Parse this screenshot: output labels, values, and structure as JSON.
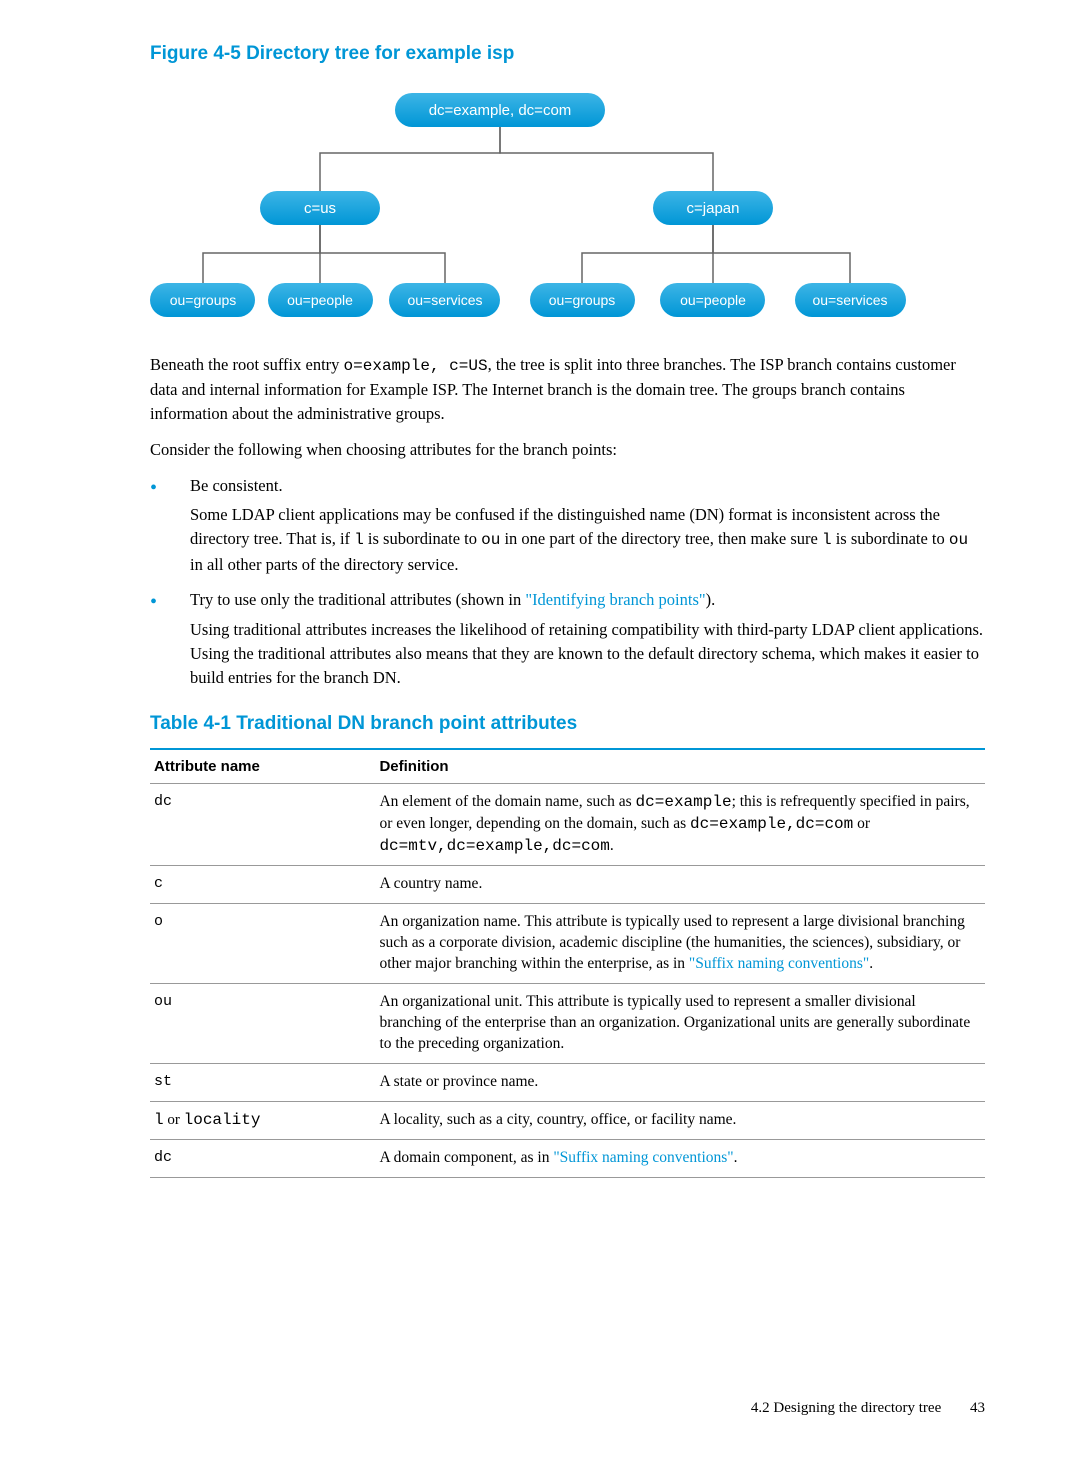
{
  "figure": {
    "title": "Figure 4-5 Directory tree for example isp",
    "nodes": {
      "root": "dc=example, dc=com",
      "us": "c=us",
      "japan": "c=japan",
      "groups": "ou=groups",
      "people": "ou=people",
      "services": "ou=services"
    }
  },
  "paragraphs": {
    "p1_a": "Beneath the root suffix entry ",
    "p1_code1": "o=example, c=US",
    "p1_b": ", the tree is split into three branches. The ISP branch contains customer data and internal information for Example ISP. The Internet branch is the domain tree. The groups branch contains information about the administrative groups.",
    "p2": "Consider the following when choosing attributes for the branch points:"
  },
  "bullets": {
    "b1_head": "Be consistent.",
    "b1_sub_a": "Some LDAP client applications may be confused if the distinguished name (DN) format is inconsistent across the directory tree. That is, if ",
    "b1_code1": "l",
    "b1_sub_b": " is subordinate to ",
    "b1_code2": "ou",
    "b1_sub_c": " in one part of the directory tree, then make sure ",
    "b1_code3": "l",
    "b1_sub_d": " is subordinate to ",
    "b1_code4": "ou",
    "b1_sub_e": " in all other parts of the directory service.",
    "b2_a": "Try to use only the traditional attributes (shown in ",
    "b2_link": "\"Identifying branch points\"",
    "b2_b": ").",
    "b2_sub": "Using traditional attributes increases the likelihood of retaining compatibility with third-party LDAP client applications. Using the traditional attributes also means that they are known to the default directory schema, which makes it easier to build entries for the branch DN."
  },
  "table": {
    "title": "Table 4-1 Traditional DN branch point attributes",
    "headers": {
      "col1": "Attribute name",
      "col2": "Definition"
    },
    "rows": [
      {
        "attr": "dc",
        "def_a": "An element of the domain name, such as ",
        "def_code1": "dc=example",
        "def_b": "; this is refrequently specified in pairs, or even longer, depending on the domain, such as ",
        "def_code2": "dc=example,dc=com",
        "def_c": " or ",
        "def_code3": "dc=mtv,dc=example,dc=com",
        "def_d": "."
      },
      {
        "attr": "c",
        "def": "A country name."
      },
      {
        "attr": "o",
        "def_a": "An organization name. This attribute is typically used to represent a large divisional branching such as a corporate division, academic discipline (the humanities, the sciences), subsidiary, or other major branching within the enterprise, as in ",
        "def_link": "\"Suffix naming conventions\"",
        "def_b": "."
      },
      {
        "attr": "ou",
        "def": "An organizational unit. This attribute is typically used to represent a smaller divisional branching of the enterprise than an organization. Organizational units are generally subordinate to the preceding organization."
      },
      {
        "attr": "st",
        "def": "A state or province name."
      },
      {
        "attr_a": "l",
        "attr_mid": " or ",
        "attr_b": "locality",
        "def": "A locality, such as a city, country, office, or facility name."
      },
      {
        "attr": "dc",
        "def_a": "A domain component, as in ",
        "def_link": "\"Suffix naming conventions\"",
        "def_b": "."
      }
    ]
  },
  "footer": {
    "section": "4.2 Designing the directory tree",
    "page": "43"
  }
}
